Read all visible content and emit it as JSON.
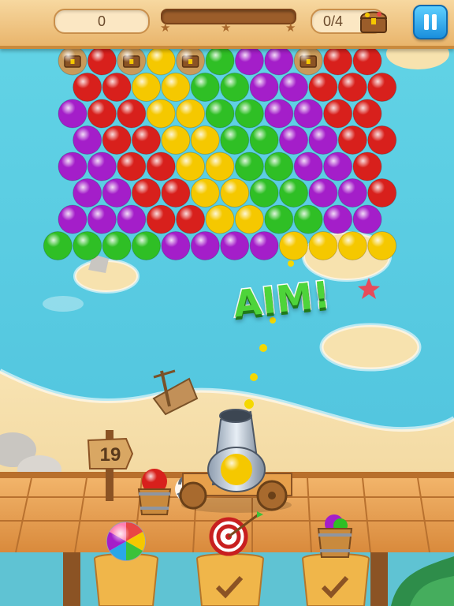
{
  "hud": {
    "score": "0",
    "level_progress": 0.0,
    "progress_stars": [
      "star-1",
      "star-2",
      "star-3"
    ],
    "goal_text": "0/4",
    "goal_icon": "treasure-chest-icon",
    "pause_icon": "pause-icon"
  },
  "board": {
    "colors": {
      "R": "#d8201c",
      "G": "#2fbf25",
      "Y": "#f5c800",
      "P": "#a41ec9",
      "T": "#c99a5a"
    },
    "rows": [
      "TRTYTGPPTRR",
      "RRYYGGPPRRR",
      "PRRYYGGPPRR",
      "PRRYYGGPPRR",
      "PPRRYYGGPPR",
      "PPRRYYGGPPR",
      "PPPRRYYGGPP",
      "GGGGPPPPYYYY"
    ]
  },
  "overlay": {
    "aim_text": "AIM!"
  },
  "cannon": {
    "loaded_bubble": "Y"
  },
  "bottom": {
    "moves_left": "19",
    "reserve_bubble": "R",
    "swap_icon": "swap-arrows-icon",
    "booster_rainbow": "rainbow-ball-icon",
    "booster_target": "target-icon",
    "booster_bucket": "bucket-bubble-icon",
    "pedestal_check": "check-icon"
  }
}
